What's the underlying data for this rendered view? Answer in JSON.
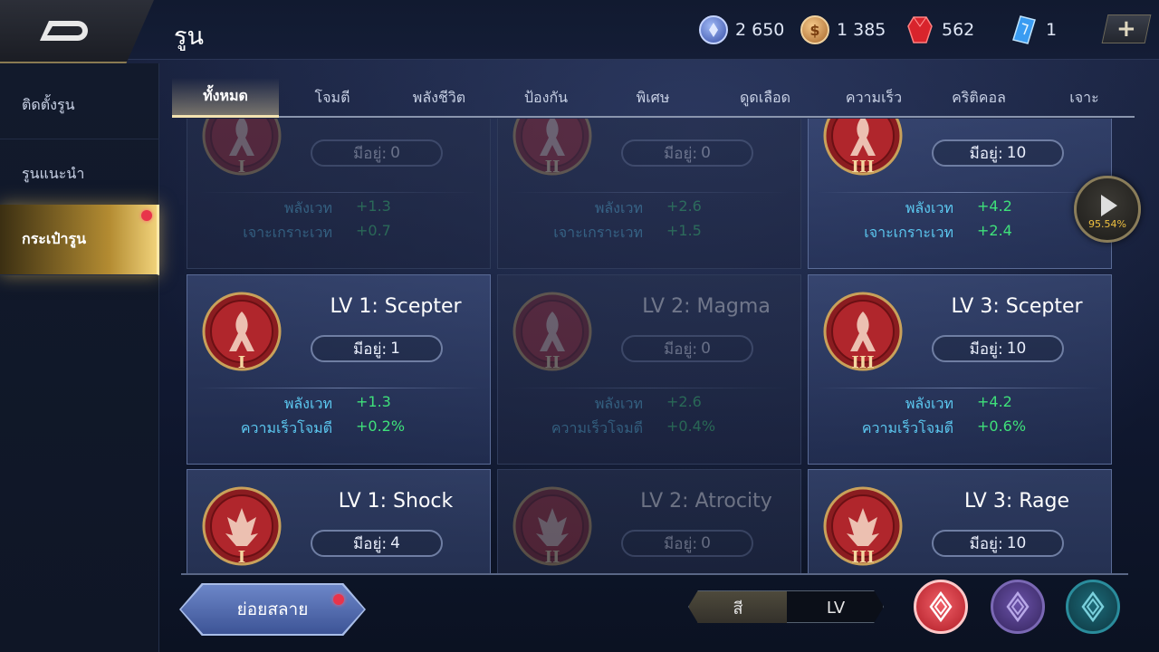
{
  "header": {
    "title": "รูน",
    "currencies": [
      {
        "name": "arcana-fragment",
        "value": "2 650",
        "color": "#5a7fd6"
      },
      {
        "name": "gold",
        "value": "1 385",
        "color": "#d99a4a"
      },
      {
        "name": "ruby",
        "value": "562",
        "color": "#e03a3a"
      },
      {
        "name": "crystal",
        "value": "1",
        "color": "#3aa0f0"
      }
    ],
    "plus_label": "+"
  },
  "sidebar": {
    "items": [
      {
        "label": "ติดตั้งรูน"
      },
      {
        "label": "รูนแนะนำ"
      },
      {
        "label": "กระเป๋ารูน"
      }
    ]
  },
  "tabs": [
    {
      "label": "ทั้งหมด"
    },
    {
      "label": "โจมตี"
    },
    {
      "label": "พลังชีวิต"
    },
    {
      "label": "ป้องกัน"
    },
    {
      "label": "พิเศษ"
    },
    {
      "label": "ดูดเลือด"
    },
    {
      "label": "ความเร็ว"
    },
    {
      "label": "คริติคอล"
    },
    {
      "label": "เจาะ"
    }
  ],
  "cards": [
    {
      "name": "",
      "roman": "I",
      "owned_label": "มีอยู่:",
      "owned": "0",
      "dim": true,
      "stats": [
        {
          "label": "พลังเวท",
          "value": "+1.3"
        },
        {
          "label": "เจาะเกราะเวท",
          "value": "+0.7"
        }
      ]
    },
    {
      "name": "",
      "roman": "II",
      "owned_label": "มีอยู่:",
      "owned": "0",
      "dim": true,
      "stats": [
        {
          "label": "พลังเวท",
          "value": "+2.6"
        },
        {
          "label": "เจาะเกราะเวท",
          "value": "+1.5"
        }
      ]
    },
    {
      "name": "",
      "roman": "III",
      "owned_label": "มีอยู่:",
      "owned": "10",
      "dim": false,
      "stats": [
        {
          "label": "พลังเวท",
          "value": "+4.2"
        },
        {
          "label": "เจาะเกราะเวท",
          "value": "+2.4"
        }
      ]
    },
    {
      "name": "LV 1: Scepter",
      "roman": "I",
      "owned_label": "มีอยู่:",
      "owned": "1",
      "dim": false,
      "stats": [
        {
          "label": "พลังเวท",
          "value": "+1.3"
        },
        {
          "label": "ความเร็วโจมตี",
          "value": "+0.2%"
        }
      ]
    },
    {
      "name": "LV 2: Magma",
      "roman": "II",
      "owned_label": "มีอยู่:",
      "owned": "0",
      "dim": true,
      "stats": [
        {
          "label": "พลังเวท",
          "value": "+2.6"
        },
        {
          "label": "ความเร็วโจมตี",
          "value": "+0.4%"
        }
      ]
    },
    {
      "name": "LV 3: Scepter",
      "roman": "III",
      "owned_label": "มีอยู่:",
      "owned": "10",
      "dim": false,
      "stats": [
        {
          "label": "พลังเวท",
          "value": "+4.2"
        },
        {
          "label": "ความเร็วโจมตี",
          "value": "+0.6%"
        }
      ]
    },
    {
      "name": "LV 1: Shock",
      "roman": "I",
      "owned_label": "มีอยู่:",
      "owned": "4",
      "dim": false,
      "stats": []
    },
    {
      "name": "LV 2: Atrocity",
      "roman": "II",
      "owned_label": "มีอยู่:",
      "owned": "0",
      "dim": true,
      "stats": []
    },
    {
      "name": "LV 3: Rage",
      "roman": "III",
      "owned_label": "มีอยู่:",
      "owned": "10",
      "dim": false,
      "stats": []
    }
  ],
  "next_button": {
    "percent": "95.54%"
  },
  "footer": {
    "dismantle_label": "ย่อยสลาย",
    "sort_options": [
      {
        "label": "สี"
      },
      {
        "label": "LV"
      }
    ],
    "color_filters": [
      {
        "name": "red-rune-filter",
        "color": "#d8323c"
      },
      {
        "name": "purple-rune-filter",
        "color": "#6c4fb0"
      },
      {
        "name": "teal-rune-filter",
        "color": "#1f8a9a"
      }
    ]
  }
}
